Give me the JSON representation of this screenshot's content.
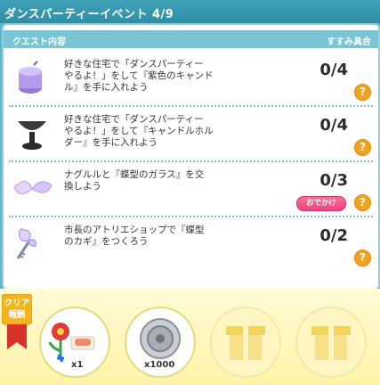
{
  "title": "ダンスパーティーイベント 4/9",
  "header": {
    "quest_label": "クエスト内容",
    "progress_label": "すすみ具合"
  },
  "quests": [
    {
      "lines": [
        "好きな住宅で「ダンスパーティー",
        "やるよ！」をして『紫色のキャンド",
        "ル』を手に入れよう"
      ],
      "progress": "0/4",
      "icon": "purple-candle-icon"
    },
    {
      "lines": [
        "好きな住宅で「ダンスパーティー",
        "やるよ！」をして『キャンドルホル",
        "ダー』を手に入れよう"
      ],
      "progress": "0/4",
      "icon": "candle-holder-icon"
    },
    {
      "lines": [
        "ナグルルと『蝶型のガラス』を交",
        "換しよう"
      ],
      "progress": "0/3",
      "icon": "butterfly-glass-icon",
      "button": "おでかけ"
    },
    {
      "lines": [
        "市長のアトリエショップで『蝶型",
        "のカギ』をつくろう"
      ],
      "progress": "0/2",
      "icon": "butterfly-key-icon"
    }
  ],
  "help_glyph": "?",
  "reward": {
    "ribbon_lines": [
      "クリア",
      "報酬"
    ],
    "items": [
      {
        "icon": "flower-and-sushi-icon",
        "count": "x1"
      },
      {
        "icon": "silver-coin-icon",
        "count": "x1000"
      },
      {
        "icon": "gift-box-icon",
        "count": ""
      },
      {
        "icon": "gift-box-icon",
        "count": ""
      }
    ]
  },
  "colors": {
    "accent": "#3fa2b8",
    "help": "#f3a21d",
    "go_button": "#e8477b",
    "reward_bg": "#fff6c4"
  }
}
